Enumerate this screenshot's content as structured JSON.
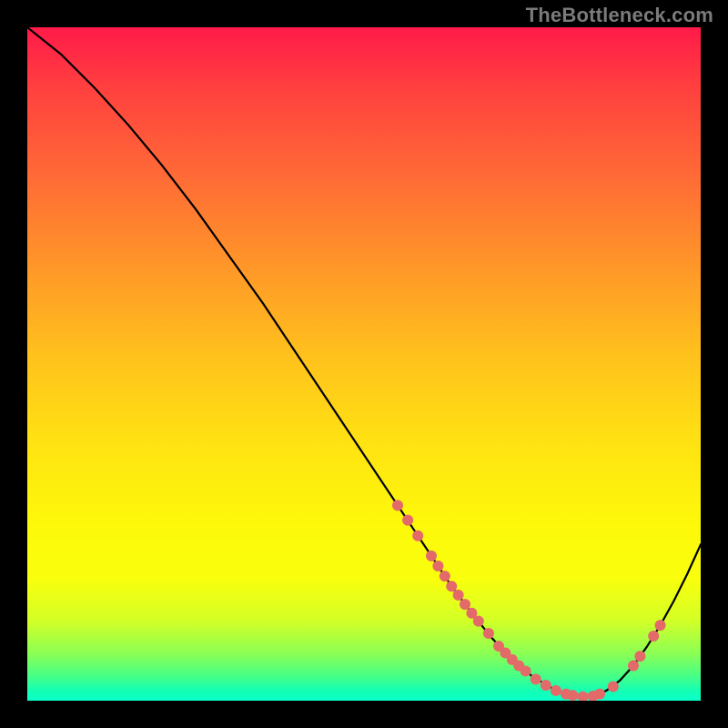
{
  "attribution": "TheBottleneck.com",
  "colors": {
    "background": "#000000",
    "curve": "#000000",
    "marker_fill": "#e46a6a",
    "marker_stroke": "#d45a5a"
  },
  "chart_data": {
    "type": "line",
    "title": "",
    "xlabel": "",
    "ylabel": "",
    "xlim": [
      0,
      100
    ],
    "ylim": [
      0,
      100
    ],
    "grid": false,
    "legend": false,
    "series": [
      {
        "name": "bottleneck-curve",
        "x": [
          0,
          5,
          10,
          15,
          20,
          25,
          30,
          35,
          40,
          45,
          50,
          55,
          58,
          60,
          63,
          66,
          69,
          72,
          75,
          78,
          80,
          82,
          84,
          86,
          88,
          90,
          92,
          94,
          96,
          98,
          100
        ],
        "y": [
          100,
          96,
          91,
          85.5,
          79.5,
          73,
          66,
          59,
          51.5,
          44,
          36.5,
          29,
          24.5,
          21.5,
          17,
          13,
          9.3,
          6.1,
          3.6,
          1.8,
          1.0,
          0.6,
          0.7,
          1.5,
          3.0,
          5.2,
          8.0,
          11.2,
          14.8,
          18.8,
          23.2
        ]
      }
    ],
    "markers": [
      {
        "x": 55.0,
        "y": 29.0,
        "r": 6
      },
      {
        "x": 56.5,
        "y": 26.8,
        "r": 6
      },
      {
        "x": 58.0,
        "y": 24.5,
        "r": 6
      },
      {
        "x": 60.0,
        "y": 21.5,
        "r": 6
      },
      {
        "x": 61.0,
        "y": 20.0,
        "r": 6
      },
      {
        "x": 62.0,
        "y": 18.5,
        "r": 6
      },
      {
        "x": 63.0,
        "y": 17.0,
        "r": 6
      },
      {
        "x": 64.0,
        "y": 15.7,
        "r": 6
      },
      {
        "x": 65.0,
        "y": 14.3,
        "r": 6
      },
      {
        "x": 66.0,
        "y": 13.0,
        "r": 6
      },
      {
        "x": 67.0,
        "y": 11.8,
        "r": 6
      },
      {
        "x": 68.5,
        "y": 10.0,
        "r": 6
      },
      {
        "x": 70.0,
        "y": 8.1,
        "r": 6
      },
      {
        "x": 71.0,
        "y": 7.1,
        "r": 6
      },
      {
        "x": 72.0,
        "y": 6.1,
        "r": 6
      },
      {
        "x": 73.0,
        "y": 5.2,
        "r": 6
      },
      {
        "x": 74.0,
        "y": 4.4,
        "r": 6
      },
      {
        "x": 75.5,
        "y": 3.2,
        "r": 6
      },
      {
        "x": 77.0,
        "y": 2.3,
        "r": 6
      },
      {
        "x": 78.5,
        "y": 1.5,
        "r": 6
      },
      {
        "x": 80.0,
        "y": 1.0,
        "r": 6
      },
      {
        "x": 81.0,
        "y": 0.8,
        "r": 6
      },
      {
        "x": 82.5,
        "y": 0.6,
        "r": 6
      },
      {
        "x": 84.0,
        "y": 0.7,
        "r": 6
      },
      {
        "x": 85.0,
        "y": 1.0,
        "r": 6
      },
      {
        "x": 87.0,
        "y": 2.1,
        "r": 6
      },
      {
        "x": 90.0,
        "y": 5.2,
        "r": 6
      },
      {
        "x": 91.0,
        "y": 6.6,
        "r": 6
      },
      {
        "x": 93.0,
        "y": 9.6,
        "r": 6
      },
      {
        "x": 94.0,
        "y": 11.2,
        "r": 6
      }
    ],
    "gradient_stops": [
      {
        "pos": 0.0,
        "color": "#ff1a49"
      },
      {
        "pos": 0.09,
        "color": "#ff403f"
      },
      {
        "pos": 0.22,
        "color": "#ff6a36"
      },
      {
        "pos": 0.36,
        "color": "#ff9828"
      },
      {
        "pos": 0.48,
        "color": "#ffbf1d"
      },
      {
        "pos": 0.62,
        "color": "#ffe312"
      },
      {
        "pos": 0.74,
        "color": "#fdf90a"
      },
      {
        "pos": 0.82,
        "color": "#f9ff0d"
      },
      {
        "pos": 0.88,
        "color": "#d4ff25"
      },
      {
        "pos": 0.93,
        "color": "#8bff54"
      },
      {
        "pos": 0.965,
        "color": "#43ff8a"
      },
      {
        "pos": 0.985,
        "color": "#14ffb4"
      },
      {
        "pos": 1.0,
        "color": "#0affc9"
      }
    ]
  }
}
